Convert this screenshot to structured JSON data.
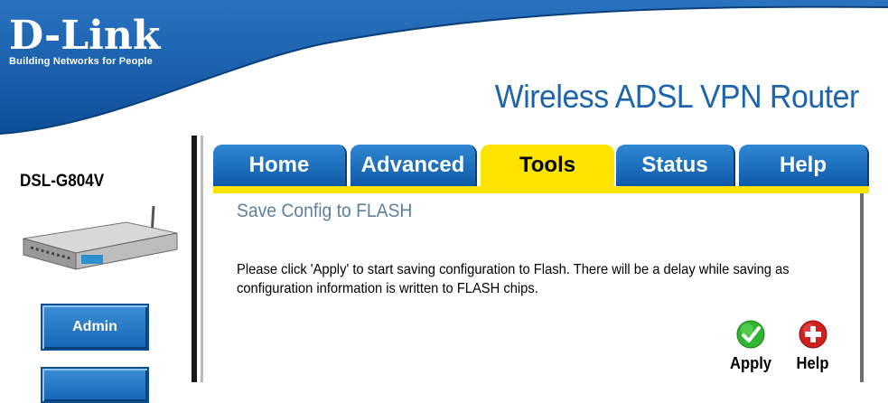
{
  "brand": {
    "logo": "D-Link",
    "tagline": "Building Networks for People"
  },
  "header": {
    "product_title": "Wireless ADSL VPN Router"
  },
  "sidebar": {
    "model": "DSL-G804V",
    "buttons": [
      {
        "label": "Admin"
      },
      {
        "label": ""
      }
    ]
  },
  "tabs": [
    {
      "label": "Home",
      "active": false
    },
    {
      "label": "Advanced",
      "active": false
    },
    {
      "label": "Tools",
      "active": true
    },
    {
      "label": "Status",
      "active": false
    },
    {
      "label": "Help",
      "active": false
    }
  ],
  "main": {
    "title": "Save Config to FLASH",
    "description": "Please click 'Apply' to start saving configuration to Flash. There will be a delay while saving as configuration information is written to FLASH chips.",
    "actions": [
      {
        "label": "Apply",
        "icon": "check-icon",
        "color": "#2fb52f"
      },
      {
        "label": "Help",
        "icon": "plus-icon",
        "color": "#d11f1f"
      }
    ]
  },
  "colors": {
    "header_blue": "#1d64ad",
    "tab_blue": "#1567b4",
    "tab_active": "#fde300"
  }
}
